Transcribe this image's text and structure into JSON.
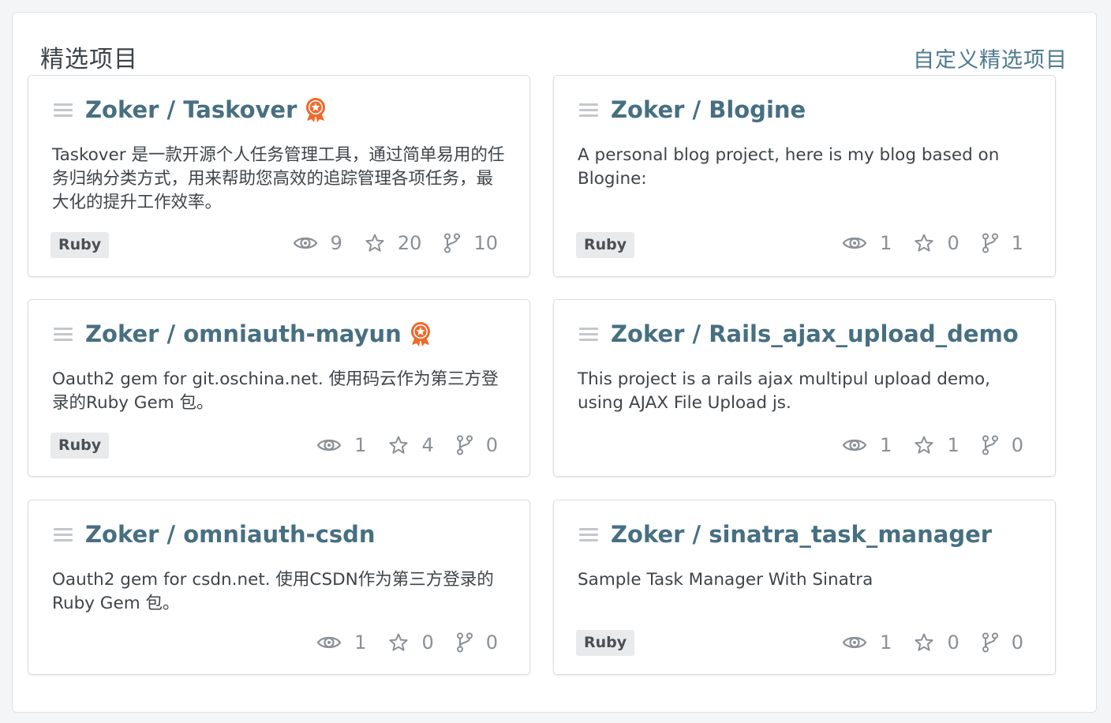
{
  "panel": {
    "title": "精选项目",
    "customize_label": "自定义精选项目"
  },
  "colors": {
    "link": "#476f82",
    "badge": "#f06a2a",
    "muted": "#8a9096"
  },
  "projects": [
    {
      "name": "Zoker / Taskover",
      "recommended": true,
      "description": "Taskover 是一款开源个人任务管理工具，通过简单易用的任务归纳分类方式，用来帮助您高效的追踪管理各项任务，最大化的提升工作效率。",
      "language": "Ruby",
      "watches": "9",
      "stars": "20",
      "forks": "10"
    },
    {
      "name": "Zoker / Blogine",
      "recommended": false,
      "description": "A personal blog project, here is my blog based on Blogine:",
      "language": "Ruby",
      "watches": "1",
      "stars": "0",
      "forks": "1"
    },
    {
      "name": "Zoker / omniauth-mayun",
      "recommended": true,
      "description": "Oauth2 gem for git.oschina.net. 使用码云作为第三方登录的Ruby Gem 包。",
      "language": "Ruby",
      "watches": "1",
      "stars": "4",
      "forks": "0"
    },
    {
      "name": "Zoker / Rails_ajax_upload_demo",
      "recommended": false,
      "description": "This project is a rails ajax multipul upload demo, using AJAX File Upload js.",
      "language": "",
      "watches": "1",
      "stars": "1",
      "forks": "0"
    },
    {
      "name": "Zoker / omniauth-csdn",
      "recommended": false,
      "description": "Oauth2 gem for csdn.net. 使用CSDN作为第三方登录的Ruby Gem 包。",
      "language": "",
      "watches": "1",
      "stars": "0",
      "forks": "0"
    },
    {
      "name": "Zoker / sinatra_task_manager",
      "recommended": false,
      "description": "Sample Task Manager With Sinatra",
      "language": "Ruby",
      "watches": "1",
      "stars": "0",
      "forks": "0"
    }
  ]
}
